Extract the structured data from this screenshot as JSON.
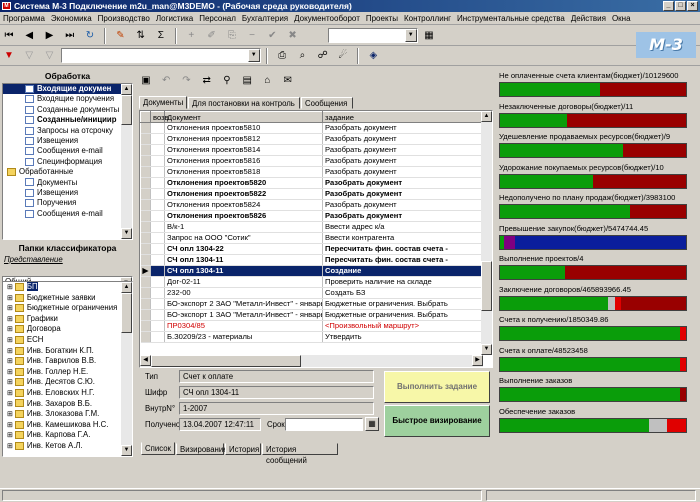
{
  "title": "Система М-3 Подключение m2u_man@M3DEMO - (Рабочая среда руководителя)",
  "menu": [
    "Программа",
    "Экономика",
    "Производство",
    "Логистика",
    "Персонал",
    "Бухгалтерия",
    "Документооборот",
    "Проекты",
    "Контроллинг",
    "Инструментальные средства",
    "Действия",
    "Окна"
  ],
  "logo": "М-3",
  "left": {
    "header": "Обработка",
    "tree": [
      {
        "label": "Входящие докумен",
        "level": 1,
        "sel": true,
        "bold": true
      },
      {
        "label": "Входящие поручения",
        "level": 1
      },
      {
        "label": "Созданные документы",
        "level": 1
      },
      {
        "label": "Созданные/инициир",
        "level": 1,
        "bold": true
      },
      {
        "label": "Запросы на отсрочку",
        "level": 1
      },
      {
        "label": "Извещения",
        "level": 1
      },
      {
        "label": "Сообщения e-mail",
        "level": 1
      },
      {
        "label": "Специнформация",
        "level": 1
      },
      {
        "label": "Обработанные",
        "level": 0
      },
      {
        "label": "Документы",
        "level": 1
      },
      {
        "label": "Извещения",
        "level": 1
      },
      {
        "label": "Поручения",
        "level": 1
      },
      {
        "label": "Сообщения e-mail",
        "level": 1
      }
    ],
    "folders_header": "Папки классификатора",
    "repr_label": "Представление",
    "repr_value": "Общий",
    "folders": [
      "БП",
      "Бюджетные заявки",
      "Бюджетные ограничения",
      "Графики",
      "Договора",
      "ЕСН",
      "Инв. Богаткин К.П.",
      "Инв. Гаврилов В.В.",
      "Инв. Голлер Н.Е.",
      "Инв. Десятов С.Ю.",
      "Инв. Еловских Н.Г.",
      "Инв. Захаров В.Б.",
      "Инв. Злоказова Г.М.",
      "Инв. Камешикова Н.С.",
      "Инв. Карпова Г.А.",
      "Инв. Кетов А.Л."
    ]
  },
  "center": {
    "tabs": [
      "Документы",
      "Для постановки на контроль",
      "Сообщения"
    ],
    "columns": [
      "возв",
      "Документ",
      "задание"
    ],
    "rows": [
      {
        "doc": "Отклонения проектов5810",
        "task": "Разобрать документ",
        "style": ""
      },
      {
        "doc": "Отклонения проектов5812",
        "task": "Разобрать документ",
        "style": ""
      },
      {
        "doc": "Отклонения проектов5814",
        "task": "Разобрать документ",
        "style": ""
      },
      {
        "doc": "Отклонения проектов5816",
        "task": "Разобрать документ",
        "style": ""
      },
      {
        "doc": "Отклонения проектов5818",
        "task": "Разобрать документ",
        "style": ""
      },
      {
        "doc": "Отклонения проектов5820",
        "task": "Разобрать документ",
        "style": "b"
      },
      {
        "doc": "Отклонения проектов5822",
        "task": "Разобрать документ",
        "style": "b"
      },
      {
        "doc": "Отклонения проектов5824",
        "task": "Разобрать документ",
        "style": ""
      },
      {
        "doc": "Отклонения проектов5826",
        "task": "Разобрать документ",
        "style": "b"
      },
      {
        "doc": "В/к-1",
        "task": "Ввести адрес к/а",
        "style": ""
      },
      {
        "doc": "Запрос на ООО \"Сотик\"",
        "task": "Ввести контрагента",
        "style": ""
      },
      {
        "doc": "СЧ опл 1304-22",
        "task": "Пересчитать фин. состав счета -",
        "style": "b"
      },
      {
        "doc": "СЧ опл 1304-11",
        "task": "Пересчитать фин. состав счета -",
        "style": "b"
      },
      {
        "doc": "СЧ опл 1304-11",
        "task": "Создание",
        "style": "s"
      },
      {
        "doc": "Дог-02-11",
        "task": "Проверить наличие на складе",
        "style": ""
      },
      {
        "doc": "232-00",
        "task": "Создать БЗ",
        "style": ""
      },
      {
        "doc": "БО-экспорт 2 ЗАО \"Металл-Инвест\" - январь",
        "task": "Бюджетные ограничения. Выбрать",
        "style": ""
      },
      {
        "doc": "БО-экспорт 1 ЗАО \"Металл-Инвест\" - январь",
        "task": "Бюджетные ограничения. Выбрать",
        "style": ""
      },
      {
        "doc": "ПР0304/85",
        "task": "<Произвольный маршрут>",
        "style": "r"
      },
      {
        "doc": "Б.З0209/23 - материалы",
        "task": "Утвердить",
        "style": ""
      }
    ],
    "details": {
      "type_label": "Тип",
      "type_value": "Счет к оплате",
      "cipher_label": "Шифр",
      "cipher_value": "СЧ опл 1304-11",
      "inner_label": "ВнутрN°",
      "inner_value": "1-2007",
      "received_label": "Получено:",
      "received_value": "13.04.2007 12:47:11",
      "due_label": "Срок:",
      "due_value": ""
    },
    "execute_button": "Выполнить задание",
    "quick_button": "Быстрое визирование",
    "bottom_tabs": [
      "Список",
      "Визирование",
      "История",
      "История сообщений"
    ]
  },
  "right": [
    {
      "label": "Не оплаченные счета клиентам(бюджет)/10129600",
      "segs": [
        [
          "#0a9d0a",
          0.54
        ],
        [
          "#990000",
          0.46
        ]
      ]
    },
    {
      "label": "Незаключенные договоры(бюджет)/11",
      "segs": [
        [
          "#0a9d0a",
          0.36
        ],
        [
          "#990000",
          0.64
        ]
      ]
    },
    {
      "label": "Удешевление продаваемых ресурсов(бюджет)/9",
      "segs": [
        [
          "#0a9d0a",
          0.66
        ],
        [
          "#990000",
          0.34
        ]
      ]
    },
    {
      "label": "Удорожание покупаемых ресурсов(бюджет)/10",
      "segs": [
        [
          "#0a9d0a",
          0.5
        ],
        [
          "#990000",
          0.5
        ]
      ]
    },
    {
      "label": "Недополучено по плану продаж(бюджет)/3983100",
      "segs": [
        [
          "#0a9d0a",
          0.7
        ],
        [
          "#990000",
          0.3
        ]
      ]
    },
    {
      "label": "Превышение закупок(бюджет)/5474744.45",
      "segs": [
        [
          "#0a9d0a",
          0.02
        ],
        [
          "#800080",
          0.06
        ],
        [
          "#0a1e9c",
          0.92
        ]
      ]
    },
    {
      "label": "Выполнение проектов/4",
      "segs": [
        [
          "#0a9d0a",
          0.35
        ],
        [
          "#990000",
          0.65
        ]
      ]
    },
    {
      "label": "Заключение договоров/465893966.45",
      "segs": [
        [
          "#0a9d0a",
          0.58
        ],
        [
          "#c0c0c0",
          0.04
        ],
        [
          "#e00000",
          0.03
        ],
        [
          "#990000",
          0.35
        ]
      ]
    },
    {
      "label": "Счета к получению/1850349.86",
      "segs": [
        [
          "#0a9d0a",
          0.97
        ],
        [
          "#e00000",
          0.03
        ]
      ]
    },
    {
      "label": "Счета к оплате/48523458",
      "segs": [
        [
          "#0a9d0a",
          0.97
        ],
        [
          "#e00000",
          0.03
        ]
      ]
    },
    {
      "label": "Выполнение заказов",
      "segs": [
        [
          "#0a9d0a",
          0.97
        ],
        [
          "#990000",
          0.03
        ]
      ]
    },
    {
      "label": "Обеспечение заказов",
      "segs": [
        [
          "#0a9d0a",
          0.8
        ],
        [
          "#c0c0c0",
          0.1
        ],
        [
          "#e00000",
          0.1
        ]
      ]
    }
  ]
}
